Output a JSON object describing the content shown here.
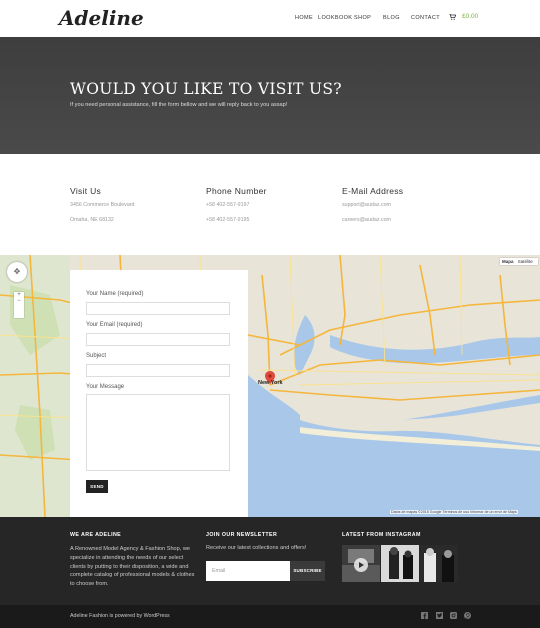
{
  "header": {
    "logo": "Adeline",
    "nav": [
      "HOME",
      "LOOKBOOK",
      "SHOP",
      "BLOG",
      "CONTACT"
    ],
    "cart_total": "£0.00"
  },
  "hero": {
    "title": "WOULD YOU LIKE TO VISIT US?",
    "subtitle": "If you need personal assistance, fill the form bellow and we will reply back to you assap!"
  },
  "contact": {
    "visit": {
      "title": "Visit Us",
      "lines": [
        "3456 Commerce Boulevard",
        "Omaha, NE 68132"
      ]
    },
    "phone": {
      "title": "Phone Number",
      "lines": [
        "+58 402-557-9197",
        "+58 402-557-9195"
      ]
    },
    "email": {
      "title": "E-Mail Address",
      "lines": [
        "support@audaz.com",
        "careers@audaz.com"
      ]
    }
  },
  "map": {
    "tabs": [
      "Mapa",
      "Satélite"
    ],
    "city_label": "New York",
    "footer": "Datos de mapas ©2015 Google   Términos de uso   Informar de un error de Maps"
  },
  "form": {
    "name_label": "Your Name (required)",
    "email_label": "Your Email (required)",
    "subject_label": "Subject",
    "message_label": "Your Message",
    "send_label": "SEND"
  },
  "footer": {
    "about_title": "WE ARE ADELINE",
    "about_text": "A Renowned Model Agency & Fashion Shop, we specialize in attending the needs of our select clients by putting to their disposition, a wide and complete catalog of professional models & clothes to choose from.",
    "newsletter_title": "JOIN OUR NEWSLETTER",
    "newsletter_text": "Receive our latest collections and offers!",
    "newsletter_placeholder": "Email",
    "subscribe_label": "SUBSCRIBE",
    "instagram_title": "LATEST FROM INSTAGRAM",
    "credit": "Adeline Fashion is powered by WordPress",
    "social_icons": [
      "facebook-icon",
      "twitter-icon",
      "instagram-icon",
      "pinterest-icon"
    ]
  }
}
